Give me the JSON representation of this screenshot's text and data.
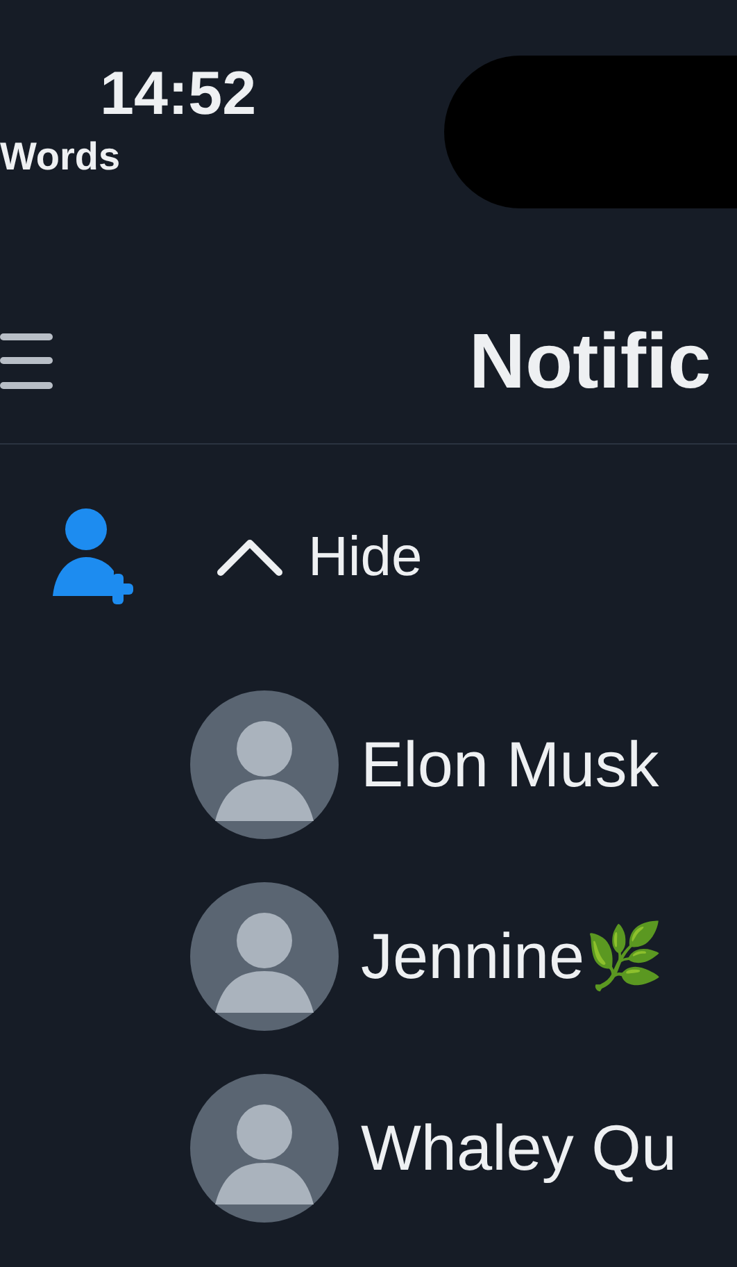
{
  "status_bar": {
    "time": "14:52",
    "carrier": "Words"
  },
  "header": {
    "title": "Notific"
  },
  "follow_group": {
    "toggle": {
      "label": "Hide",
      "expanded": true
    },
    "users": [
      {
        "name": "Elon Musk"
      },
      {
        "name": "Jennine🌿"
      },
      {
        "name": "Whaley Qu"
      }
    ]
  }
}
